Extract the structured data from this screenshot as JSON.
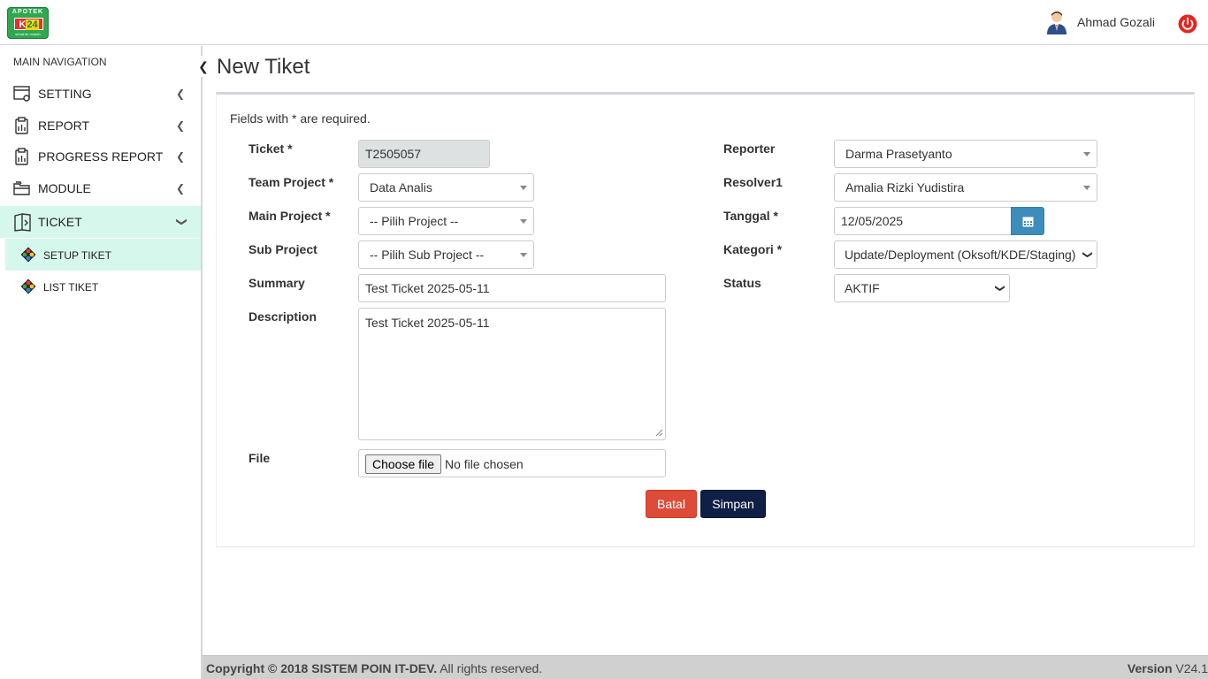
{
  "header": {
    "logo": {
      "line1": "APOTEK",
      "k": "K",
      "num": "24",
      "tagline": "sehat itu mudah"
    },
    "user_name": "Ahmad Gozali"
  },
  "sidebar": {
    "nav_header": "MAIN NAVIGATION",
    "items": [
      {
        "label": "SETTING",
        "icon": "settings-window-icon"
      },
      {
        "label": "REPORT",
        "icon": "clipboard-icon"
      },
      {
        "label": "PROGRESS REPORT",
        "icon": "clipboard-icon"
      },
      {
        "label": "MODULE",
        "icon": "folders-icon"
      },
      {
        "label": "TICKET",
        "icon": "ticket-icon"
      }
    ],
    "sub_items": [
      {
        "label": "SETUP TIKET",
        "icon": "diamond-dots-icon"
      },
      {
        "label": "LIST TIKET",
        "icon": "diamond-dots-icon"
      }
    ]
  },
  "main": {
    "title": "New Tiket",
    "required_note": "Fields with * are required.",
    "form": {
      "ticket": {
        "label": "Ticket *",
        "value": "T2505057"
      },
      "team_project": {
        "label": "Team Project *",
        "value": "Data Analis"
      },
      "main_project": {
        "label": "Main Project *",
        "value": "-- Pilih Project --"
      },
      "sub_project": {
        "label": "Sub Project",
        "value": "-- Pilih Sub Project --"
      },
      "summary": {
        "label": "Summary",
        "value": "Test Ticket 2025-05-11"
      },
      "description": {
        "label": "Description",
        "value": "Test Ticket 2025-05-11"
      },
      "file": {
        "label": "File",
        "button": "Choose file",
        "status": "No file chosen"
      },
      "reporter": {
        "label": "Reporter",
        "value": "Darma Prasetyanto"
      },
      "resolver1": {
        "label": "Resolver1",
        "value": "Amalia Rizki Yudistira"
      },
      "tanggal": {
        "label": "Tanggal *",
        "value": "12/05/2025"
      },
      "kategori": {
        "label": "Kategori *",
        "value": "Update/Deployment (Oksoft/KDE/Staging)"
      },
      "status": {
        "label": "Status",
        "value": "AKTIF"
      }
    },
    "buttons": {
      "cancel": "Batal",
      "save": "Simpan"
    }
  },
  "footer": {
    "copyright_prefix": "Copyright © 2018",
    "brand": "SISTEM POIN IT-DEV.",
    "suffix": "All rights reserved.",
    "version_label": "Version",
    "version": "V24.1"
  },
  "colors": {
    "active_bg": "#d6f7ec",
    "cancel": "#dd4b39",
    "save": "#0f1f45",
    "calendar": "#3c8dbc"
  }
}
